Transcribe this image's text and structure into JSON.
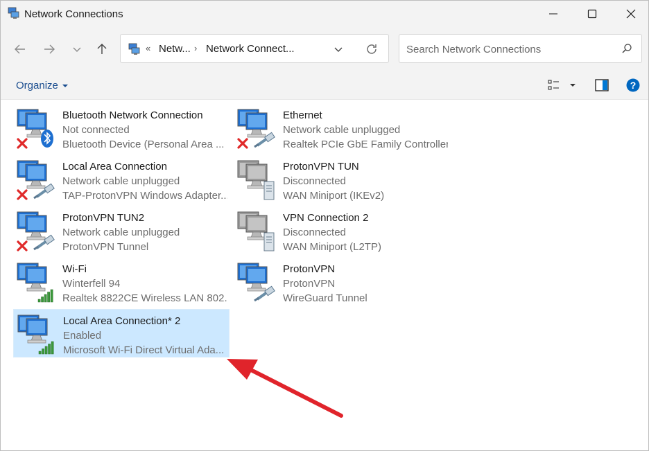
{
  "window": {
    "title": "Network Connections",
    "app_icon": "network-connections-icon",
    "controls": [
      "minimize-icon",
      "maximize-icon",
      "close-icon"
    ]
  },
  "navigation": {
    "back_icon": "arrow-left-icon",
    "forward_icon": "arrow-right-icon",
    "recent_icon": "chevron-down-icon",
    "up_icon": "arrow-up-icon",
    "address": {
      "overflow": "«",
      "segments": [
        "Netw...",
        "Network Connect..."
      ],
      "separator": "›"
    },
    "search": {
      "placeholder": "Search Network Connections",
      "value": ""
    }
  },
  "commandbar": {
    "organize_label": "Organize",
    "icons": [
      "change-view-icon",
      "view-options-caret-icon",
      "preview-pane-icon",
      "help-icon"
    ]
  },
  "connections": [
    {
      "name": "Bluetooth Network Connection",
      "status": "Not connected",
      "device": "Bluetooth Device (Personal Area ...",
      "badge": "bluetooth-icon",
      "disabled_mark": true,
      "selected": false,
      "greyed": false
    },
    {
      "name": "Ethernet",
      "status": "Network cable unplugged",
      "device": "Realtek PCIe GbE Family Controller",
      "badge": "ethernet-cable-icon",
      "disabled_mark": true,
      "selected": false,
      "greyed": false
    },
    {
      "name": "Local Area Connection",
      "status": "Network cable unplugged",
      "device": "TAP-ProtonVPN Windows Adapter...",
      "badge": "ethernet-cable-icon",
      "disabled_mark": true,
      "selected": false,
      "greyed": false
    },
    {
      "name": "ProtonVPN TUN",
      "status": "Disconnected",
      "device": "WAN Miniport (IKEv2)",
      "badge": "server-icon",
      "disabled_mark": false,
      "selected": false,
      "greyed": true
    },
    {
      "name": "ProtonVPN TUN2",
      "status": "Network cable unplugged",
      "device": "ProtonVPN Tunnel",
      "badge": "ethernet-cable-icon",
      "disabled_mark": true,
      "selected": false,
      "greyed": false
    },
    {
      "name": "VPN Connection 2",
      "status": "Disconnected",
      "device": "WAN Miniport (L2TP)",
      "badge": "server-icon",
      "disabled_mark": false,
      "selected": false,
      "greyed": true
    },
    {
      "name": "Wi-Fi",
      "status": "Winterfell 94",
      "device": "Realtek 8822CE Wireless LAN 802....",
      "badge": "wifi-signal-icon",
      "disabled_mark": false,
      "selected": false,
      "greyed": false
    },
    {
      "name": "ProtonVPN",
      "status": "ProtonVPN",
      "device": "WireGuard Tunnel",
      "badge": "ethernet-cable-icon",
      "disabled_mark": false,
      "selected": false,
      "greyed": false
    },
    {
      "name": "Local Area Connection* 2",
      "status": "Enabled",
      "device": "Microsoft Wi-Fi Direct Virtual Ada...",
      "badge": "wifi-signal-icon",
      "disabled_mark": false,
      "selected": true,
      "greyed": false
    }
  ],
  "annotation": {
    "arrow_color": "#e0242b"
  },
  "colors": {
    "accent": "#0067c0",
    "selection": "#cce8ff",
    "link": "#1a4d8f"
  }
}
